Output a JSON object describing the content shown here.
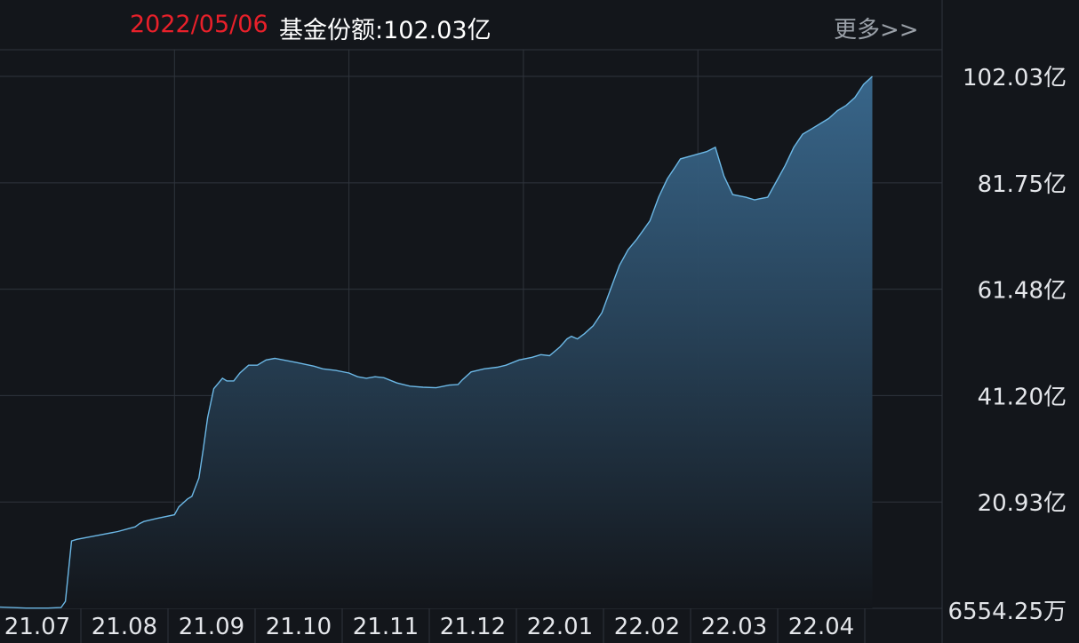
{
  "header": {
    "date": "2022/05/06",
    "value_label": "基金份额:102.03亿",
    "more_label": "更多>>"
  },
  "colors": {
    "background": "#13161b",
    "grid": "#2f343c",
    "line": "#6cb8e6",
    "fill_top": "#3a6a90",
    "fill_bottom": "#13161b",
    "date_text": "#e8202a",
    "more_text": "#9aa0a8"
  },
  "chart_data": {
    "type": "area",
    "y_unit": "亿",
    "ylim": [
      0.655425,
      102.03
    ],
    "y_tick_values": [
      0.655425,
      20.93,
      41.2,
      61.48,
      81.75,
      102.03
    ],
    "y_tick_labels": [
      "6554.25万",
      "20.93亿",
      "41.20亿",
      "61.48亿",
      "81.75亿",
      "102.03亿"
    ],
    "x_tick_labels": [
      "21.07",
      "21.08",
      "21.09",
      "21.10",
      "21.11",
      "21.12",
      "22.01",
      "22.02",
      "22.03",
      "22.04"
    ],
    "xlim": [
      0,
      10.8
    ],
    "grid": true,
    "series": [
      {
        "x": [
          0.0,
          0.3,
          0.55,
          0.7,
          0.75,
          0.82,
          0.88,
          1.1,
          1.35,
          1.55,
          1.6,
          1.65,
          1.8,
          2.0,
          2.05,
          2.15,
          2.2,
          2.28,
          2.33,
          2.38,
          2.45,
          2.55,
          2.6,
          2.68,
          2.75,
          2.85,
          2.95,
          3.05,
          3.15,
          3.4,
          3.6,
          3.7,
          3.85,
          4.0,
          4.1,
          4.2,
          4.3,
          4.4,
          4.55,
          4.7,
          4.85,
          5.0,
          5.15,
          5.25,
          5.3,
          5.4,
          5.55,
          5.7,
          5.8,
          5.95,
          6.1,
          6.2,
          6.3,
          6.42,
          6.5,
          6.55,
          6.62,
          6.7,
          6.8,
          6.9,
          7.0,
          7.1,
          7.2,
          7.3,
          7.45,
          7.55,
          7.65,
          7.75,
          7.8,
          7.95,
          8.1,
          8.2,
          8.3,
          8.4,
          8.55,
          8.65,
          8.7,
          8.8,
          8.9,
          9.0,
          9.1,
          9.2,
          9.3,
          9.4,
          9.5,
          9.6,
          9.7,
          9.8,
          9.9,
          10.0
        ],
        "y": [
          0.9,
          0.7,
          0.7,
          0.8,
          2.0,
          13.5,
          13.8,
          14.5,
          15.3,
          16.2,
          16.8,
          17.2,
          17.8,
          18.5,
          20.0,
          21.5,
          22.0,
          25.5,
          31.0,
          37.0,
          42.5,
          44.5,
          44.0,
          44.0,
          45.5,
          47.0,
          47.0,
          48.0,
          48.3,
          47.5,
          46.8,
          46.3,
          46.0,
          45.5,
          44.8,
          44.5,
          44.8,
          44.6,
          43.6,
          43.0,
          42.8,
          42.7,
          43.2,
          43.3,
          44.2,
          45.7,
          46.3,
          46.6,
          47.0,
          48.0,
          48.5,
          49.0,
          48.8,
          50.5,
          52.0,
          52.5,
          52.0,
          53.0,
          54.5,
          57.0,
          61.5,
          66.0,
          69.0,
          71.0,
          74.5,
          79.0,
          82.5,
          85.0,
          86.3,
          87.0,
          87.7,
          88.5,
          83.0,
          79.5,
          79.0,
          78.5,
          78.7,
          79.0,
          82.0,
          85.0,
          88.5,
          91.0,
          92.0,
          93.0,
          94.0,
          95.5,
          96.5,
          98.0,
          100.5,
          102.03
        ]
      }
    ]
  }
}
